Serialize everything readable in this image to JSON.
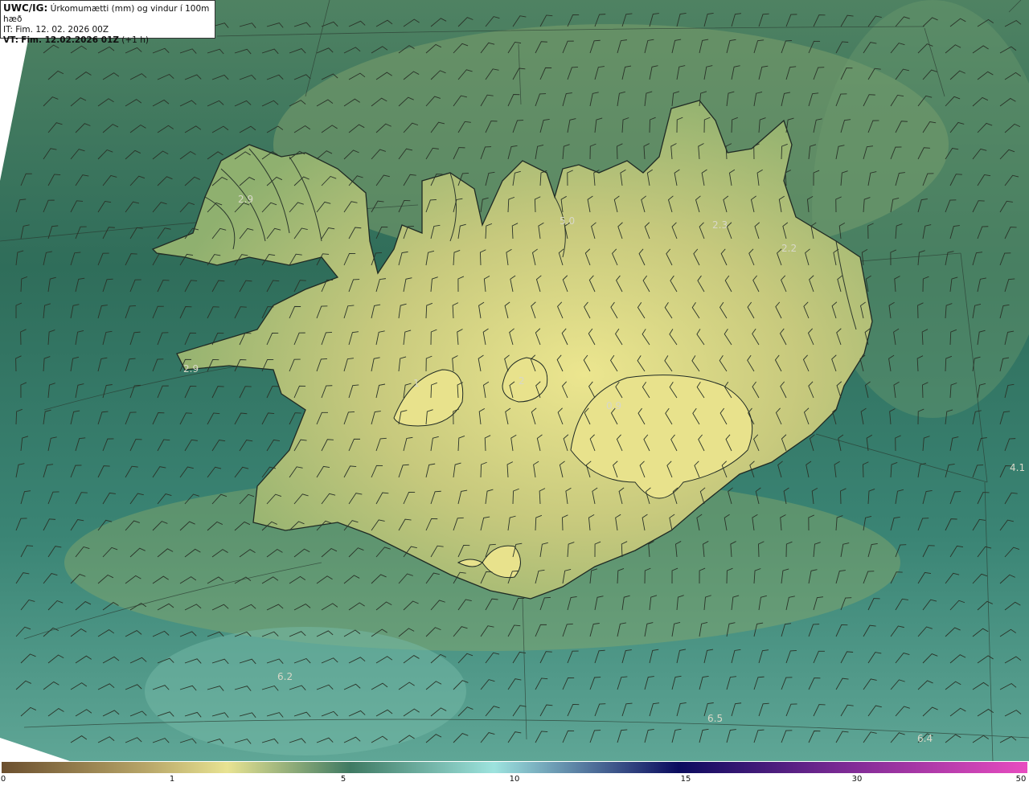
{
  "header": {
    "product": "UWC/IG:",
    "title": "Úrkomumætti (mm) og vindur í 100m hæð",
    "it_line": "IT: Fim. 12. 02. 2026 00Z",
    "vt_prefix": "VT:",
    "vt_bold": "Fim. 12.02.2026 01Z",
    "vt_suffix": "(+1 h)"
  },
  "map_values": [
    "2.9",
    "5.0",
    "2.3",
    "2.2",
    "2.9",
    "2",
    "0.9",
    "1",
    "4.1",
    "6.2",
    "6.5",
    "6.4"
  ],
  "colorbar": {
    "ticks": [
      "0",
      "1",
      "5",
      "10",
      "15",
      "30",
      "50"
    ],
    "colors": [
      "#6b4f2e",
      "#b7a568",
      "#e8e392",
      "#3f7a63",
      "#9de3de",
      "#0b0b5e",
      "#7b2a94",
      "#e84cc0"
    ]
  },
  "colors": {
    "sea": "#3e7d66",
    "land_low": "#7fa36d",
    "land_high": "#e6e08e",
    "coast": "#1f2a24"
  }
}
